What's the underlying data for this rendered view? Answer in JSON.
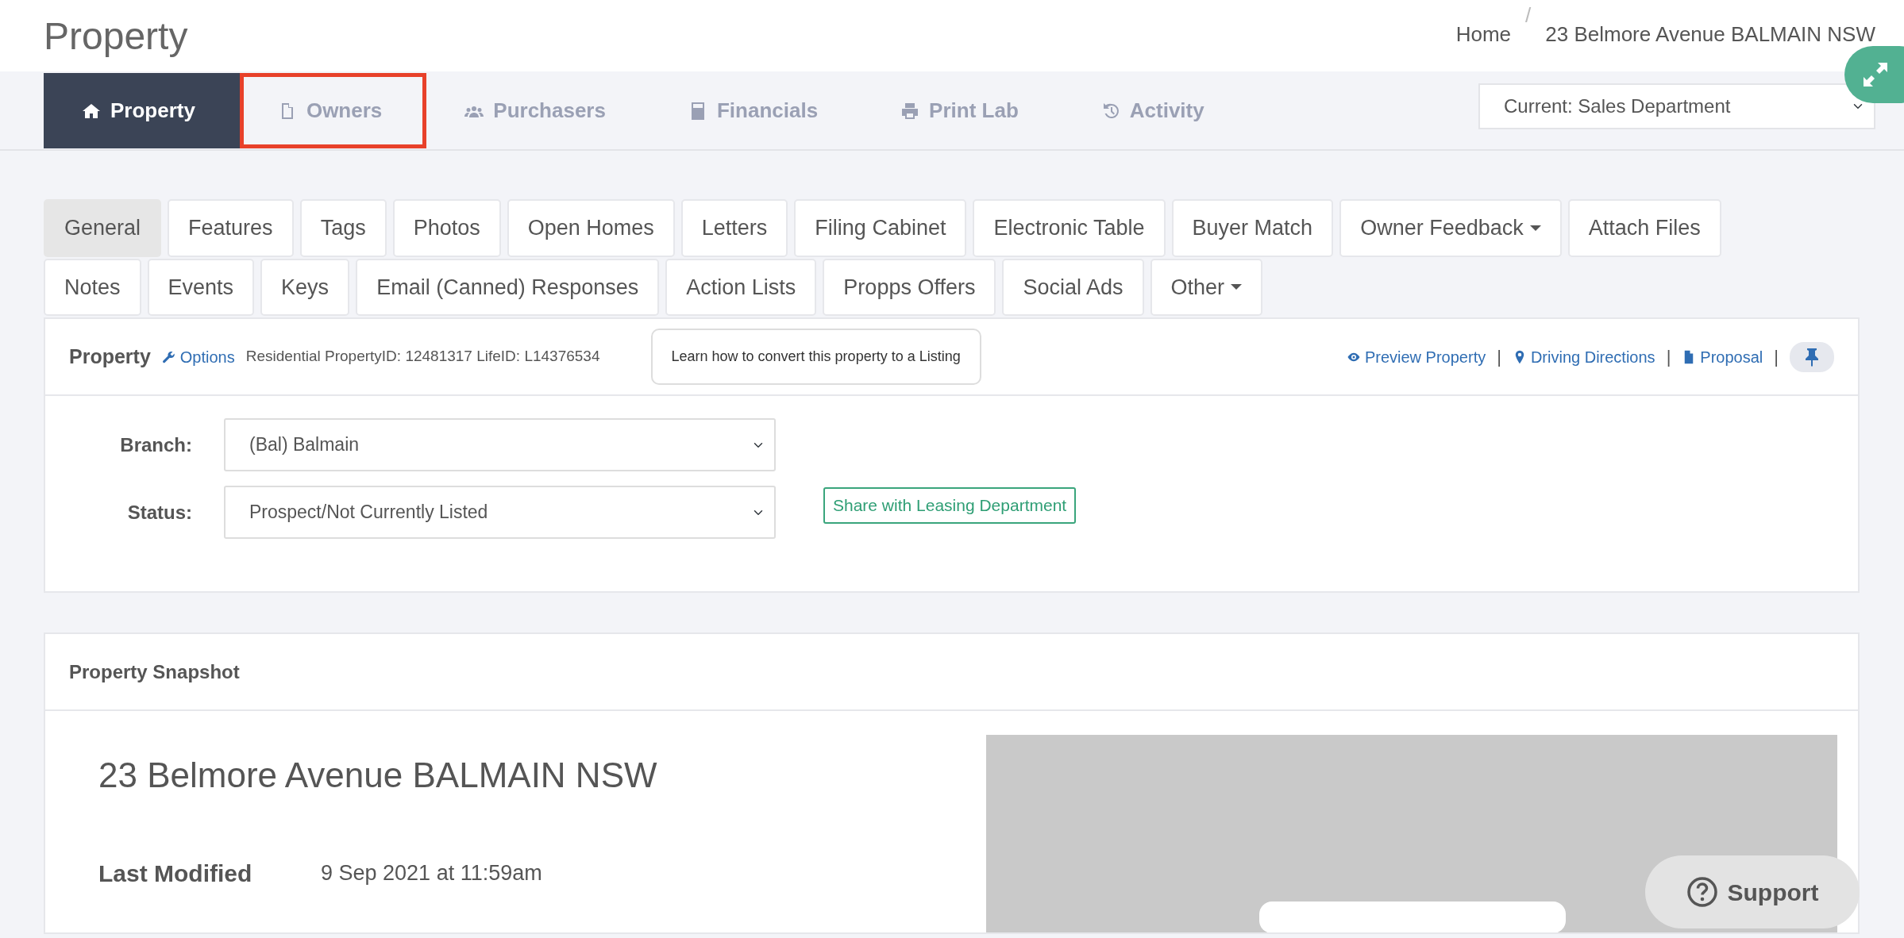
{
  "page": {
    "title": "Property"
  },
  "breadcrumb": [
    {
      "label": "Home",
      "separator": "/"
    },
    {
      "label": "23 Belmore Avenue BALMAIN NSW"
    }
  ],
  "main_tabs": [
    {
      "label": "Property",
      "selected": true,
      "highlighted": false
    },
    {
      "label": "Owners",
      "selected": false,
      "highlighted": true
    },
    {
      "label": "Purchasers",
      "selected": false,
      "highlighted": false
    },
    {
      "label": "Financials",
      "selected": false,
      "highlighted": false
    },
    {
      "label": "Print Lab",
      "selected": false,
      "highlighted": false
    },
    {
      "label": "Activity",
      "selected": false,
      "highlighted": false
    }
  ],
  "department_select": {
    "value": "Current: Sales Department"
  },
  "sub_tab_rows": [
    {
      "tabs": [
        {
          "label": "General",
          "selected": true,
          "dropdown": false
        },
        {
          "label": "Features",
          "selected": false,
          "dropdown": false
        },
        {
          "label": "Tags",
          "selected": false,
          "dropdown": false
        },
        {
          "label": "Photos",
          "selected": false,
          "dropdown": false
        },
        {
          "label": "Open Homes",
          "selected": false,
          "dropdown": false
        },
        {
          "label": "Letters",
          "selected": false,
          "dropdown": false
        },
        {
          "label": "Filing Cabinet",
          "selected": false,
          "dropdown": false
        },
        {
          "label": "Electronic Table",
          "selected": false,
          "dropdown": false
        },
        {
          "label": "Buyer Match",
          "selected": false,
          "dropdown": false
        },
        {
          "label": "Owner Feedback",
          "selected": false,
          "dropdown": true
        },
        {
          "label": "Attach Files",
          "selected": false,
          "dropdown": false
        }
      ]
    },
    {
      "tabs": [
        {
          "label": "Notes",
          "selected": false,
          "dropdown": false
        },
        {
          "label": "Events",
          "selected": false,
          "dropdown": false
        },
        {
          "label": "Keys",
          "selected": false,
          "dropdown": false
        },
        {
          "label": "Email (Canned) Responses",
          "selected": false,
          "dropdown": false
        },
        {
          "label": "Action Lists",
          "selected": false,
          "dropdown": false
        },
        {
          "label": "Propps Offers",
          "selected": false,
          "dropdown": false
        },
        {
          "label": "Social Ads",
          "selected": false,
          "dropdown": false
        },
        {
          "label": "Other",
          "selected": false,
          "dropdown": true
        }
      ]
    }
  ],
  "property_panel": {
    "title": "Property",
    "options_link": "Options",
    "info": "Residential PropertyID: 12481317 LifeID: L14376534",
    "tip_button": "Learn how to convert this property to a Listing",
    "links": [
      {
        "label": "Preview Property",
        "kind": "eye",
        "separator": "|"
      },
      {
        "label": "Driving Directions",
        "kind": "pin",
        "separator": "|"
      },
      {
        "label": "Proposal",
        "kind": "file",
        "separator": "|"
      }
    ]
  },
  "form": [
    {
      "label": "Branch:",
      "value": "(Bal) Balmain"
    },
    {
      "label": "Status:",
      "value": "Prospect/Not Currently Listed"
    }
  ],
  "share_button": "Share with Leasing Department",
  "snapshot": {
    "title": "Property Snapshot",
    "address": "23 Belmore Avenue BALMAIN NSW",
    "fields": [
      {
        "label": "Last Modified",
        "value": "9 Sep 2021 at 11:59am"
      }
    ]
  },
  "support_button": "Support"
}
